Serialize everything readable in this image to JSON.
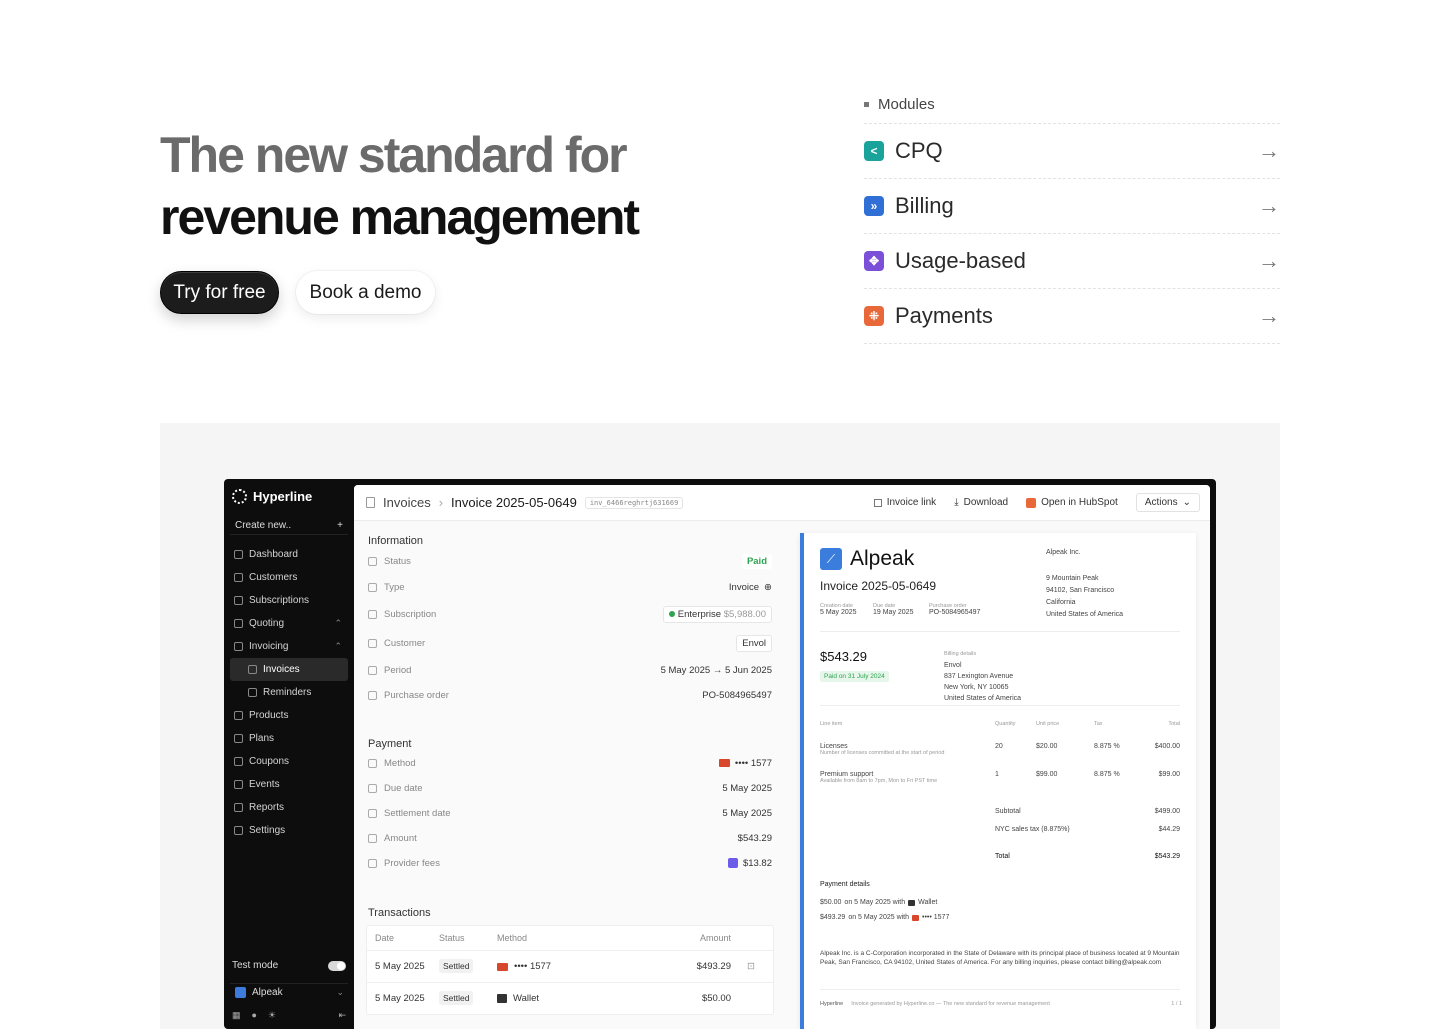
{
  "hero": {
    "title_line1": "The new standard for",
    "title_line2": "revenue management",
    "cta_primary": "Try for free",
    "cta_secondary": "Book a demo"
  },
  "modules": {
    "heading": "Modules",
    "items": [
      {
        "label": "CPQ",
        "icon": "cpq-icon",
        "color": "#1aa39a"
      },
      {
        "label": "Billing",
        "icon": "billing-icon",
        "color": "#2f6fd6"
      },
      {
        "label": "Usage-based",
        "icon": "usage-icon",
        "color": "#7b4fd8"
      },
      {
        "label": "Payments",
        "icon": "payments-icon",
        "color": "#e8683a"
      }
    ]
  },
  "app": {
    "brand": "Hyperline",
    "create_new": "Create new..",
    "nav": [
      {
        "label": "Dashboard"
      },
      {
        "label": "Customers"
      },
      {
        "label": "Subscriptions"
      },
      {
        "label": "Quoting"
      },
      {
        "label": "Invoicing"
      },
      {
        "label": "Invoices"
      },
      {
        "label": "Reminders"
      },
      {
        "label": "Products"
      },
      {
        "label": "Plans"
      },
      {
        "label": "Coupons"
      },
      {
        "label": "Events"
      },
      {
        "label": "Reports"
      },
      {
        "label": "Settings"
      }
    ],
    "test_mode": "Test mode",
    "workspace": "Alpeak",
    "breadcrumb": {
      "parent": "Invoices",
      "current": "Invoice 2025-05-0649",
      "id": "inv_6466reghrtj631669"
    },
    "actions": {
      "invoice_link": "Invoice link",
      "download": "Download",
      "hubspot": "Open in HubSpot",
      "more": "Actions"
    },
    "information": {
      "title": "Information",
      "status_label": "Status",
      "status_value": "Paid",
      "type_label": "Type",
      "type_value": "Invoice",
      "subscription_label": "Subscription",
      "subscription_plan": "Enterprise",
      "subscription_price": "$5,988.00",
      "customer_label": "Customer",
      "customer_value": "Envol",
      "period_label": "Period",
      "period_value": "5 May 2025 → 5 Jun 2025",
      "po_label": "Purchase order",
      "po_value": "PO-5084965497"
    },
    "payment": {
      "title": "Payment",
      "method_label": "Method",
      "method_value": "•••• 1577",
      "due_label": "Due date",
      "due_value": "5 May 2025",
      "settlement_label": "Settlement date",
      "settlement_value": "5 May 2025",
      "amount_label": "Amount",
      "amount_value": "$543.29",
      "fees_label": "Provider fees",
      "fees_value": "$13.82"
    },
    "transactions": {
      "title": "Transactions",
      "columns": {
        "date": "Date",
        "status": "Status",
        "method": "Method",
        "amount": "Amount"
      },
      "rows": [
        {
          "date": "5 May 2025",
          "status": "Settled",
          "method": "•••• 1577",
          "amount": "$493.29"
        },
        {
          "date": "5 May 2025",
          "status": "Settled",
          "method": "Wallet",
          "amount": "$50.00"
        }
      ]
    },
    "invoice": {
      "company": "Alpeak",
      "number": "Invoice 2025-05-0649",
      "issuer_name": "Alpeak Inc.",
      "issuer_addr1": "9 Mountain Peak",
      "issuer_addr2": "94102, San Francisco",
      "issuer_addr3": "California",
      "issuer_addr4": "United States of America",
      "creation_label": "Creation date",
      "creation_value": "5 May 2025",
      "due_label": "Due date",
      "due_value": "19 May 2025",
      "po_label": "Purchase order",
      "po_value": "PO-5084965497",
      "total": "$543.29",
      "paid_on": "Paid on 31 July 2024",
      "billing_label": "Billing details",
      "bill_name": "Envol",
      "bill_addr1": "837 Lexington Avenue",
      "bill_addr2": "New York, NY 10065",
      "bill_addr3": "United States of America",
      "cols": {
        "item": "Line item",
        "qty": "Quantity",
        "unit": "Unit price",
        "tax": "Tax",
        "total": "Total"
      },
      "lines": [
        {
          "name": "Licenses",
          "desc": "Number of licenses committed at the start of period",
          "qty": "20",
          "unit": "$20.00",
          "tax": "8.875 %",
          "total": "$400.00"
        },
        {
          "name": "Premium support",
          "desc": "Available from 8am to 7pm, Mon to Fri PST time",
          "qty": "1",
          "unit": "$99.00",
          "tax": "8.875 %",
          "total": "$99.00"
        }
      ],
      "subtotal_label": "Subtotal",
      "subtotal_value": "$499.00",
      "tax_label": "NYC sales tax (8.875%)",
      "tax_value": "$44.29",
      "total_label": "Total",
      "total_value": "$543.29",
      "payment_details_label": "Payment details",
      "pay1_amount": "$50.00",
      "pay1_text": "on 5 May 2025 with",
      "pay1_method": "Wallet",
      "pay2_amount": "$493.29",
      "pay2_text": "on 5 May 2025 with",
      "pay2_method": "•••• 1577",
      "legal": "Alpeak Inc. is a C-Corporation incorporated in the State of Delaware with its principal place of business located at 9 Mountain Peak, San Francisco, CA 94102, United States of America. For any billing inquiries, please contact billing@alpeak.com",
      "footer_brand": "Hyperline",
      "footer_text": "Invoice generated by Hyperline.co — The new standard for revenue management",
      "page": "1 / 1"
    }
  }
}
